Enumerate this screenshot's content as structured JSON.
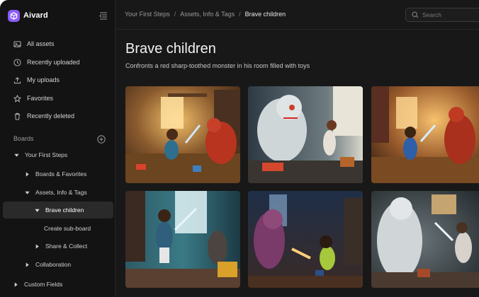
{
  "app": {
    "name": "Aivard"
  },
  "sidebar": {
    "nav": [
      {
        "label": "All assets",
        "icon": "image-icon"
      },
      {
        "label": "Recently uploaded",
        "icon": "clock-icon"
      },
      {
        "label": "My uploads",
        "icon": "upload-icon"
      },
      {
        "label": "Favorites",
        "icon": "star-icon"
      },
      {
        "label": "Recently deleted",
        "icon": "trash-icon"
      }
    ],
    "boards_label": "Boards",
    "tree": [
      {
        "label": "Your First Steps",
        "expanded": true
      },
      {
        "label": "Boards & Favorites",
        "expanded": false
      },
      {
        "label": "Assets, Info & Tags",
        "expanded": true
      },
      {
        "label": "Brave children",
        "expanded": true,
        "selected": true
      },
      {
        "label": "Create sub-board"
      },
      {
        "label": "Share & Collect",
        "expanded": false
      },
      {
        "label": "Collaboration",
        "expanded": false
      },
      {
        "label": "Custom Fields",
        "expanded": false
      }
    ]
  },
  "breadcrumb": [
    "Your First Steps",
    "Assets, Info & Tags",
    "Brave children"
  ],
  "search": {
    "placeholder": "Search"
  },
  "board": {
    "title": "Brave children",
    "description": "Confronts a red sharp-toothed monster in his room filled with toys"
  },
  "colors": {
    "accent": "#8b5cf6",
    "background": "#181818",
    "sidebar": "#131313"
  }
}
